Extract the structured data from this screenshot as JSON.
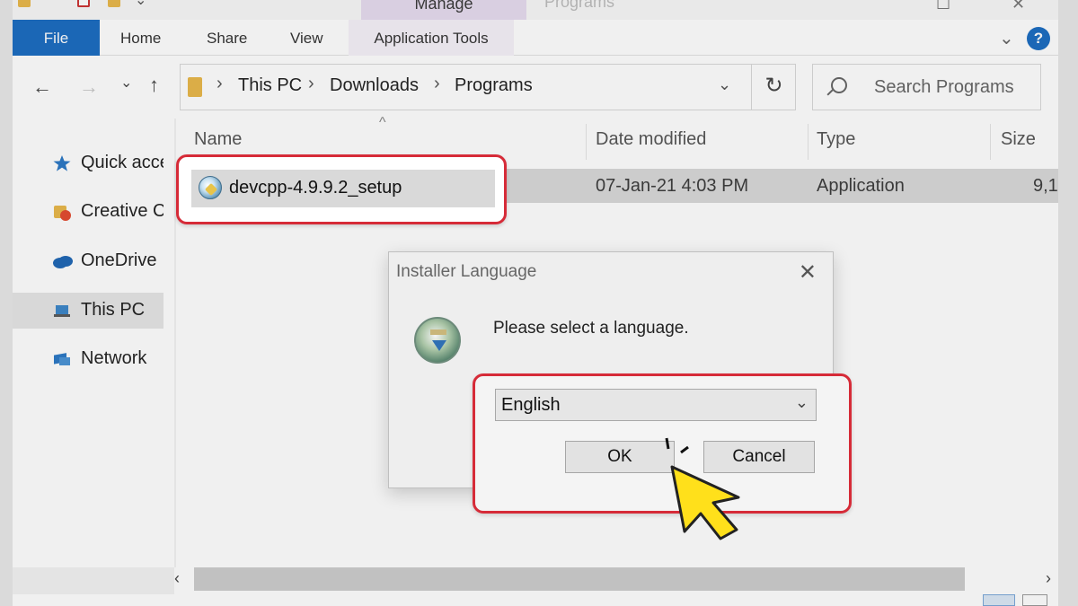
{
  "window": {
    "title": "Programs",
    "contextual_tab": "Manage"
  },
  "ribbon": {
    "tabs": [
      "File",
      "Home",
      "Share",
      "View",
      "Application Tools"
    ],
    "help_label": "?"
  },
  "nav": {
    "breadcrumb": [
      "This PC",
      "Downloads",
      "Programs"
    ],
    "search_placeholder": "Search Programs"
  },
  "sidebar": {
    "items": [
      {
        "label": "Quick access",
        "icon": "star-icon"
      },
      {
        "label": "Creative Cloud Files",
        "icon": "creative-cloud-icon"
      },
      {
        "label": "OneDrive",
        "icon": "cloud-icon"
      },
      {
        "label": "This PC",
        "icon": "computer-icon"
      },
      {
        "label": "Network",
        "icon": "network-icon"
      }
    ]
  },
  "file_list": {
    "columns": [
      "Name",
      "Date modified",
      "Type",
      "Size"
    ],
    "rows": [
      {
        "name": "devcpp-4.9.9.2_setup",
        "date": "07-Jan-21 4:03 PM",
        "type": "Application",
        "size": "9,1"
      }
    ]
  },
  "dialog": {
    "title": "Installer Language",
    "message": "Please select a language.",
    "selected_language": "English",
    "ok_label": "OK",
    "cancel_label": "Cancel"
  },
  "colors": {
    "accent_blue": "#1a6cc1",
    "highlight_red": "#d62b38",
    "cursor_yellow": "#ffe01b"
  }
}
